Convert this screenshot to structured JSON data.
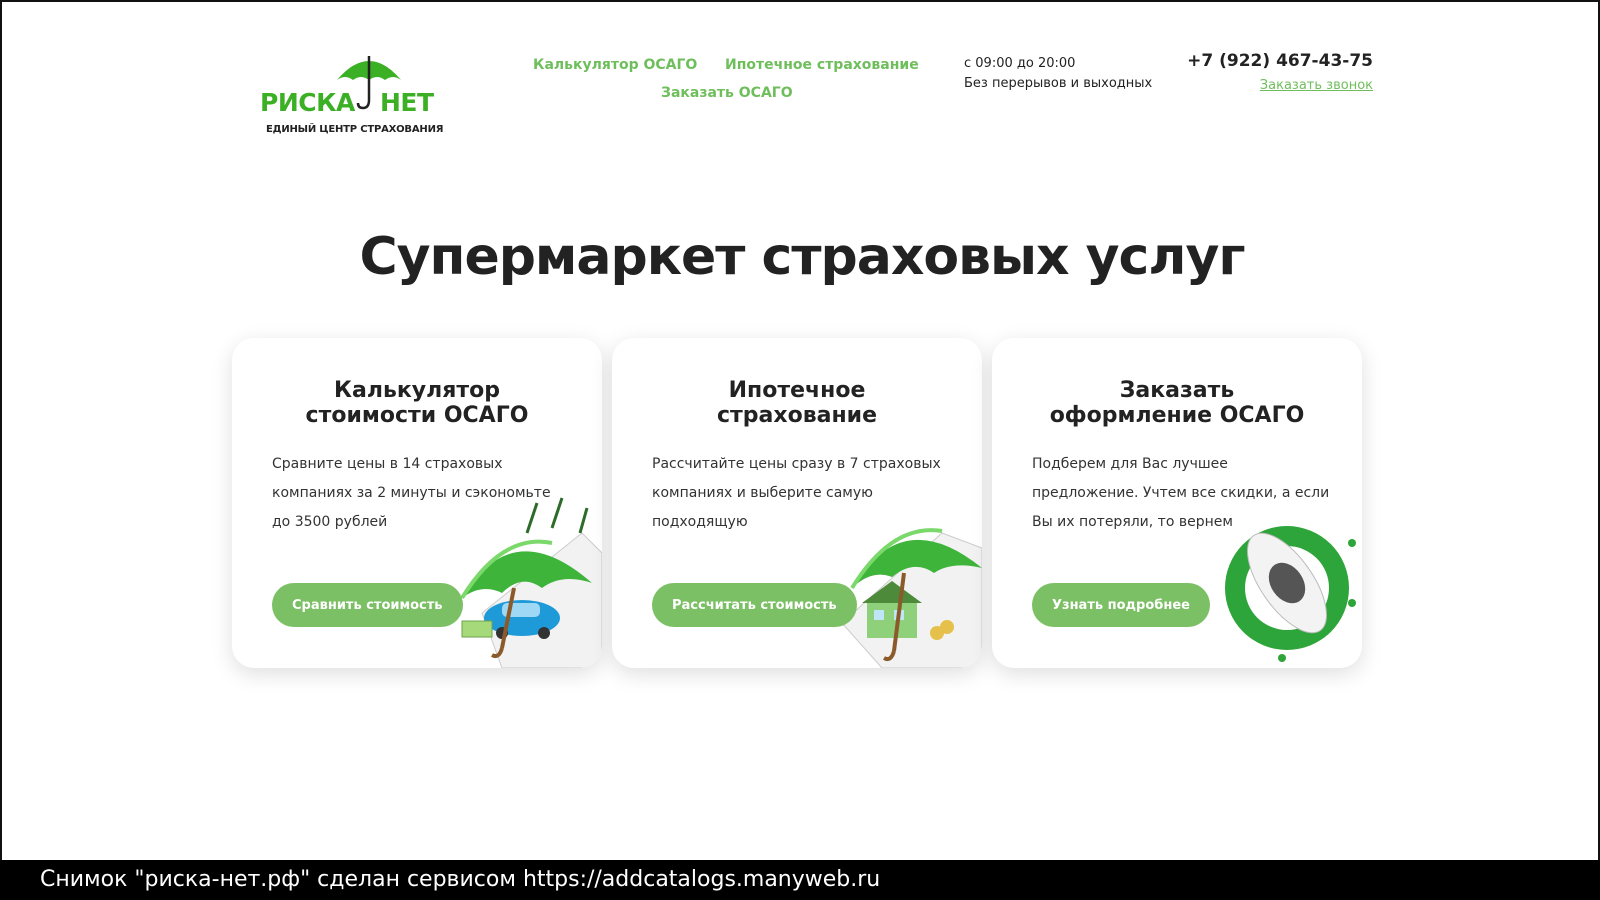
{
  "brand": {
    "name_left": "РИСКА",
    "name_right": "НЕТ",
    "tagline": "ЕДИНЫЙ ЦЕНТР СТРАХОВАНИЯ",
    "accent_color": "#3cb025"
  },
  "nav": {
    "items": [
      "Калькулятор ОСАГО",
      "Ипотечное страхование",
      "Заказать ОСАГО"
    ],
    "color": "#6fbe5c"
  },
  "contacts": {
    "hours_line1": "с 09:00 до 20:00",
    "hours_line2": "Без перерывов и выходных",
    "phone": "+7 (922) 467-43-75",
    "callback_link": "Заказать звонок"
  },
  "hero": {
    "title": "Супермаркет страховых услуг"
  },
  "cards": [
    {
      "title": "Калькулятор\nстоимости ОСАГО",
      "text": "Сравните цены в 14 страховых компаниях за 2 минуты и сэкономьте до 3500 рублей",
      "button": "Сравнить стоимость",
      "illustration": "umbrella-car-insurance-icon"
    },
    {
      "title": "Ипотечное\nстрахование",
      "text": "Рассчитайте цены сразу в 7 страховых компаниях и выберите самую подходящую",
      "button": "Рассчитать стоимость",
      "illustration": "umbrella-house-insurance-icon"
    },
    {
      "title": "Заказать\nоформление ОСАГО",
      "text": "Подберем для Вас лучшее предложение. Учтем все скидки, а если Вы их потеряли, то вернем",
      "button": "Узнать подробнее",
      "illustration": "car-top-view-icon"
    }
  ],
  "button_color": "#7cc065",
  "watermark": "Снимок \"риска-нет.рф\" сделан сервисом https://addcatalogs.manyweb.ru"
}
